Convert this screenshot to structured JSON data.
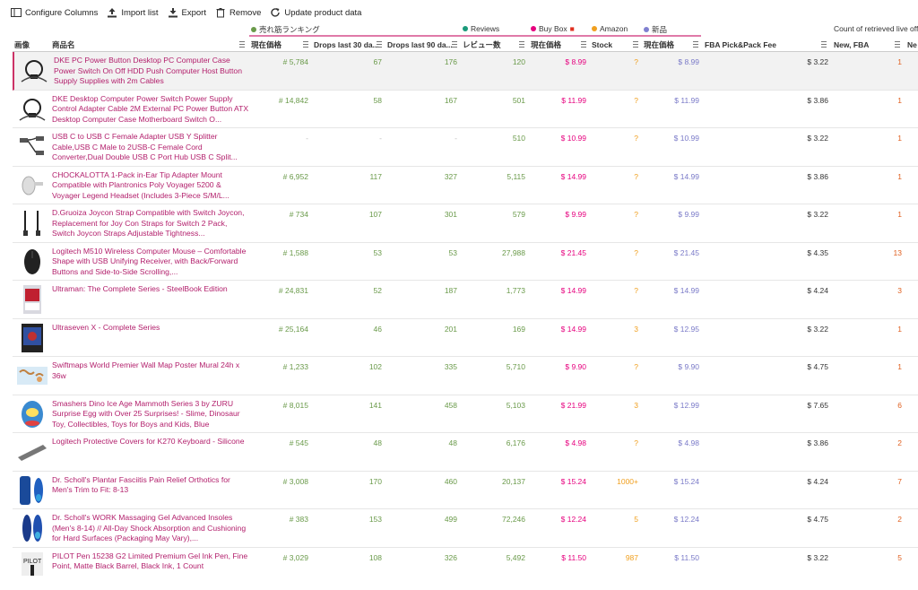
{
  "toolbar": {
    "configure": "Configure Columns",
    "import": "Import list",
    "export": "Export",
    "remove": "Remove",
    "update": "Update product data"
  },
  "groups": {
    "sales_rank": "売れ筋ランキング",
    "reviews": "Reviews",
    "buybox": "Buy Box",
    "amazon": "Amazon",
    "new": "新品",
    "count": "Count of retrieved live off"
  },
  "columns": {
    "image": "画像",
    "name": "商品名",
    "rank_current": "現在価格",
    "drops30": "Drops last 30 da...",
    "drops90": "Drops last 90 da...",
    "reviews": "レビュー数",
    "bb_current": "現在価格",
    "stock": "Stock",
    "new_current": "現在価格",
    "fba_fee": "FBA Pick&Pack Fee",
    "new_fba": "New, FBA",
    "ne": "Ne"
  },
  "colors": {
    "sales_rank": "#6a9a4a",
    "reviews": "#1a9a7a",
    "buybox": "#e6007e",
    "amazon": "#f0a020",
    "new": "#8080d0"
  },
  "rows": [
    {
      "title": "DKE PC Power Button Desktop PC Computer Case Power Switch On Off HDD Push Computer Host Button Supply Supplies with 2m Cables",
      "rank": "# 5,784",
      "d30": "67",
      "d90": "176",
      "rev": "120",
      "bb": "$ 8.99",
      "stock": "?",
      "new": "$ 8.99",
      "fee": "$ 3.22",
      "cnt": "1",
      "thumb": "cable"
    },
    {
      "title": "DKE Desktop Computer Power Switch Power Supply Control Adapter Cable 2M External PC Power Button ATX Desktop Computer Case Motherboard Switch O...",
      "rank": "# 14,842",
      "d30": "58",
      "d90": "167",
      "rev": "501",
      "bb": "$ 11.99",
      "stock": "?",
      "new": "$ 11.99",
      "fee": "$ 3.86",
      "cnt": "1",
      "thumb": "cable"
    },
    {
      "title": "USB C to USB C Female Adapter USB Y Splitter Cable,USB C Male to 2USB-C Female Cord Converter,Dual Double USB C Port Hub USB C Split...",
      "rank": "-",
      "d30": "-",
      "d90": "-",
      "rev": "510",
      "bb": "$ 10.99",
      "stock": "?",
      "new": "$ 10.99",
      "fee": "$ 3.22",
      "cnt": "1",
      "thumb": "usb"
    },
    {
      "title": "CHOCKALOTTA 1-Pack in-Ear Tip Adapter Mount Compatible with Plantronics Poly Voyager 5200 & Voyager Legend Headset (Includes 3-Piece S/M/L...",
      "rank": "# 6,952",
      "d30": "117",
      "d90": "327",
      "rev": "5,115",
      "bb": "$ 14.99",
      "stock": "?",
      "new": "$ 14.99",
      "fee": "$ 3.86",
      "cnt": "1",
      "thumb": "ear"
    },
    {
      "title": "D.Gruoiza Joycon Strap Compatible with Switch Joycon, Replacement for Joy Con Straps for Switch 2 Pack, Switch Joycon Straps Adjustable Tightness...",
      "rank": "# 734",
      "d30": "107",
      "d90": "301",
      "rev": "579",
      "bb": "$ 9.99",
      "stock": "?",
      "new": "$ 9.99",
      "fee": "$ 3.22",
      "cnt": "1",
      "thumb": "strap"
    },
    {
      "title": "Logitech M510 Wireless Computer Mouse – Comfortable Shape with USB Unifying Receiver, with Back/Forward Buttons and Side-to-Side Scrolling,...",
      "rank": "# 1,588",
      "d30": "53",
      "d90": "53",
      "rev": "27,988",
      "bb": "$ 21.45",
      "stock": "?",
      "new": "$ 21.45",
      "fee": "$ 4.35",
      "cnt": "13",
      "thumb": "mouse"
    },
    {
      "title": "Ultraman: The Complete Series - SteelBook Edition",
      "rank": "# 24,831",
      "d30": "52",
      "d90": "187",
      "rev": "1,773",
      "bb": "$ 14.99",
      "stock": "?",
      "new": "$ 14.99",
      "fee": "$ 4.24",
      "cnt": "3",
      "thumb": "book"
    },
    {
      "title": "Ultraseven X - Complete Series",
      "rank": "# 25,164",
      "d30": "46",
      "d90": "201",
      "rev": "169",
      "bb": "$ 14.99",
      "stock": "3",
      "new": "$ 12.95",
      "fee": "$ 3.22",
      "cnt": "1",
      "thumb": "dvd"
    },
    {
      "title": "Swiftmaps World Premier Wall Map Poster Mural 24h x 36w",
      "rank": "# 1,233",
      "d30": "102",
      "d90": "335",
      "rev": "5,710",
      "bb": "$ 9.90",
      "stock": "?",
      "new": "$ 9.90",
      "fee": "$ 4.75",
      "cnt": "1",
      "thumb": "map"
    },
    {
      "title": "Smashers Dino Ice Age Mammoth Series 3 by ZURU Surprise Egg with Over 25 Surprises! - Slime, Dinosaur Toy, Collectibles, Toys for Boys and Kids, Blue",
      "rank": "# 8,015",
      "d30": "141",
      "d90": "458",
      "rev": "5,103",
      "bb": "$ 21.99",
      "stock": "3",
      "new": "$ 12.99",
      "fee": "$ 7.65",
      "cnt": "6",
      "thumb": "egg"
    },
    {
      "title": "Logitech Protective Covers for K270 Keyboard - Silicone",
      "rank": "# 545",
      "d30": "48",
      "d90": "48",
      "rev": "6,176",
      "bb": "$ 4.98",
      "stock": "?",
      "new": "$ 4.98",
      "fee": "$ 3.86",
      "cnt": "2",
      "thumb": "kb"
    },
    {
      "title": "Dr. Scholl's Plantar Fasciitis Pain Relief Orthotics for Men's Trim to Fit: 8-13",
      "rank": "# 3,008",
      "d30": "170",
      "d90": "460",
      "rev": "20,137",
      "bb": "$ 15.24",
      "stock": "1000+",
      "new": "$ 15.24",
      "fee": "$ 4.24",
      "cnt": "7",
      "thumb": "insole"
    },
    {
      "title": "Dr. Scholl's WORK Massaging Gel Advanced Insoles (Men's 8-14) // All-Day Shock Absorption and Cushioning for Hard Surfaces (Packaging May Vary),...",
      "rank": "# 383",
      "d30": "153",
      "d90": "499",
      "rev": "72,246",
      "bb": "$ 12.24",
      "stock": "5",
      "new": "$ 12.24",
      "fee": "$ 4.75",
      "cnt": "2",
      "thumb": "insole2"
    },
    {
      "title": "PILOT Pen 15238 G2 Limited Premium Gel Ink Pen, Fine Point, Matte Black Barrel, Black Ink, 1 Count",
      "rank": "# 3,029",
      "d30": "108",
      "d90": "326",
      "rev": "5,492",
      "bb": "$ 11.50",
      "stock": "987",
      "new": "$ 11.50",
      "fee": "$ 3.22",
      "cnt": "5",
      "thumb": "pen"
    }
  ]
}
